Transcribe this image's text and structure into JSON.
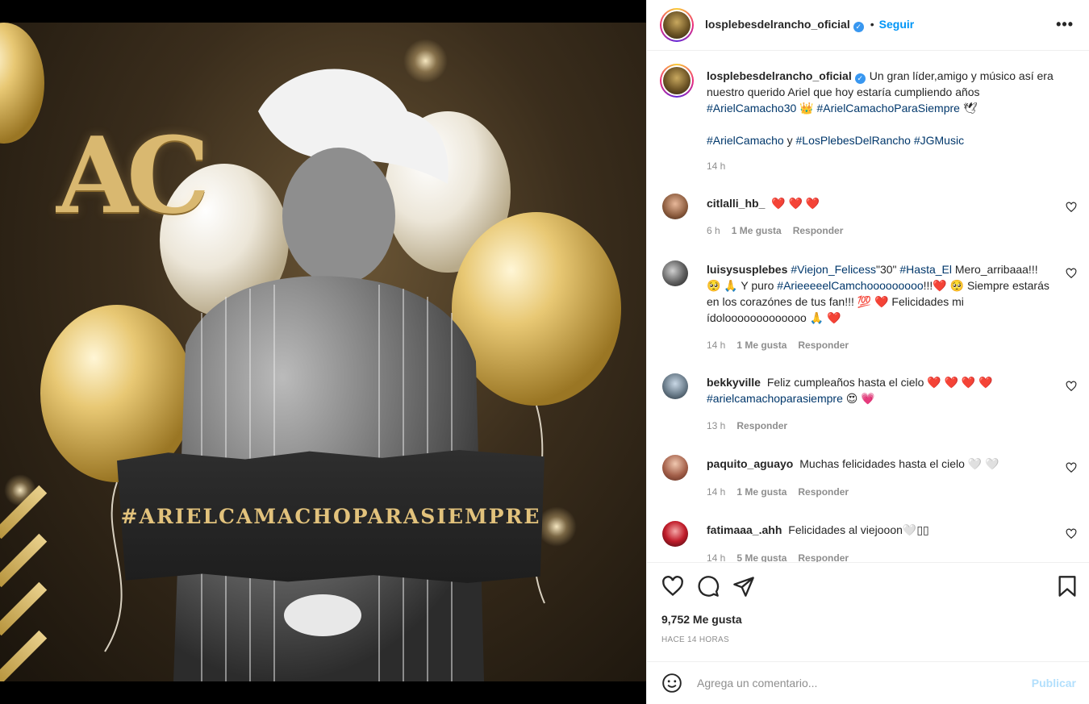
{
  "post": {
    "image_hashtag": "#ARIELCAMACHOPARASIEMPRE",
    "image_monogram": "AC",
    "image_description": ""
  },
  "header": {
    "username": "losplebesdelrancho_oficial",
    "separator": "•",
    "follow_label": "Seguir",
    "more_icon": "more-options-icon"
  },
  "caption": {
    "username": "losplebesdelrancho_oficial",
    "line1_text": "Un gran líder,amigo y músico así era nuestro querido Ariel que hoy estaría cumpliendo años",
    "tag1": "#ArielCamacho30",
    "emoji1": "👑",
    "tag2": "#ArielCamachoParaSiempre",
    "emoji2": "🕊",
    "tag3": "#ArielCamacho",
    "connector": "y",
    "tag4": "#LosPlebesDelRancho",
    "tag5": "#JGMusic",
    "time": "14 h"
  },
  "comments": [
    {
      "username": "citlalli_hb_",
      "text": "❤️ ❤️ ❤️",
      "time": "6 h",
      "likes": "1 Me gusta",
      "reply": "Responder"
    },
    {
      "username": "luisysusplebes",
      "tag1": "#Viejon_Felicess",
      "text1": "\"30\"",
      "tag2": "#Hasta_El",
      "text2": "Mero_arribaaa!!! 🥺 🙏 Y puro",
      "tag3": "#ArieeeeelCamchooooooooo",
      "text3": "!!!❤️ 🥺 Siempre estarás en los corazónes de tus fan!!! 💯 ❤️ Felicidades mi ídolooooooooooooo 🙏 ❤️",
      "time": "14 h",
      "likes": "1 Me gusta",
      "reply": "Responder"
    },
    {
      "username": "bekkyville",
      "text": "Feliz cumpleaños hasta el cielo ❤️ ❤️ ❤️ ❤️",
      "tag": "#arielcamachoparasiempre",
      "emoji": "😍 💗",
      "time": "13 h",
      "reply": "Responder"
    },
    {
      "username": "paquito_aguayo",
      "text": "Muchas felicidades hasta el cielo 🤍 🤍",
      "time": "14 h",
      "likes": "1 Me gusta",
      "reply": "Responder"
    },
    {
      "username": "fatimaaa_.ahh",
      "text": "Felicidades al viejooon🤍▯▯",
      "time": "14 h",
      "likes": "5 Me gusta",
      "reply": "Responder"
    }
  ],
  "actions": {
    "like_icon": "heart-icon",
    "comment_icon": "comment-icon",
    "share_icon": "send-icon",
    "save_icon": "bookmark-icon"
  },
  "stats": {
    "likes": "9,752 Me gusta",
    "time_ago": "HACE 14 HORAS"
  },
  "composer": {
    "emoji_icon": "emoji-icon",
    "placeholder": "Agrega un comentario...",
    "publish_label": "Publicar"
  },
  "colors": {
    "link": "#00376b",
    "follow": "#0095f6",
    "publish_disabled": "#b2dffc",
    "meta_gray": "#8e8e8e",
    "gold": "#d9b870"
  }
}
